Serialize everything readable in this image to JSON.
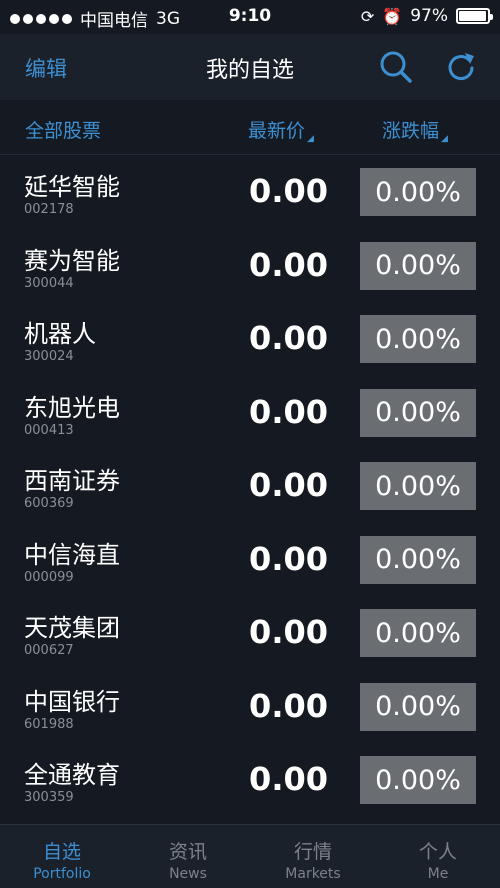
{
  "status_bar": {
    "carrier": "中国电信",
    "network": "3G",
    "time": "9:10",
    "battery": "97%",
    "battery_level": 0.97
  },
  "nav": {
    "edit_label": "编辑",
    "title": "我的自选"
  },
  "columns": {
    "all_stocks": "全部股票",
    "latest_price": "最新价",
    "change_pct": "涨跌幅"
  },
  "stocks": [
    {
      "name": "延华智能",
      "code": "002178",
      "price": "0.00",
      "change": "0.00%"
    },
    {
      "name": "赛为智能",
      "code": "300044",
      "price": "0.00",
      "change": "0.00%"
    },
    {
      "name": "机器人",
      "code": "300024",
      "price": "0.00",
      "change": "0.00%"
    },
    {
      "name": "东旭光电",
      "code": "000413",
      "price": "0.00",
      "change": "0.00%"
    },
    {
      "name": "西南证券",
      "code": "600369",
      "price": "0.00",
      "change": "0.00%"
    },
    {
      "name": "中信海直",
      "code": "000099",
      "price": "0.00",
      "change": "0.00%"
    },
    {
      "name": "天茂集团",
      "code": "000627",
      "price": "0.00",
      "change": "0.00%"
    },
    {
      "name": "中国银行",
      "code": "601988",
      "price": "0.00",
      "change": "0.00%"
    },
    {
      "name": "全通教育",
      "code": "300359",
      "price": "0.00",
      "change": "0.00%"
    }
  ],
  "tabs": [
    {
      "zh": "自选",
      "en": "Portfolio"
    },
    {
      "zh": "资讯",
      "en": "News"
    },
    {
      "zh": "行情",
      "en": "Markets"
    },
    {
      "zh": "个人",
      "en": "Me"
    }
  ],
  "colors": {
    "accent": "#3d8fd1",
    "background": "#151a22",
    "change_box": "#6a6e73"
  }
}
